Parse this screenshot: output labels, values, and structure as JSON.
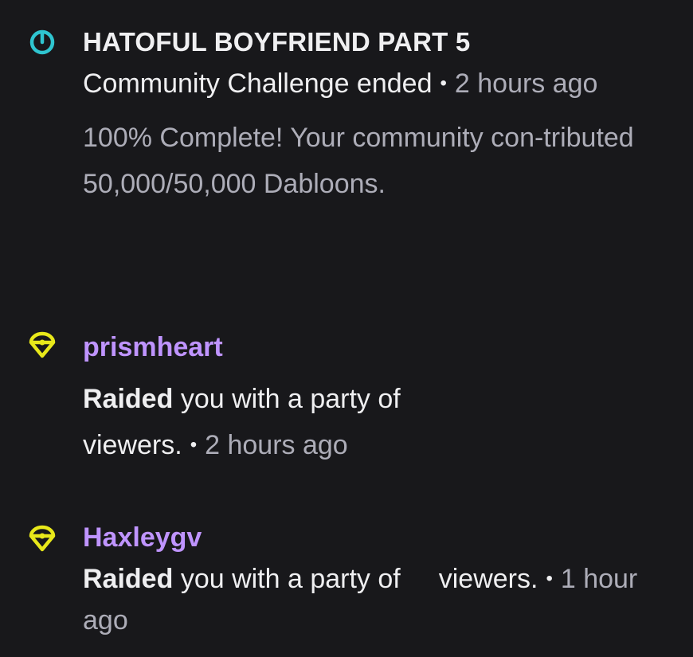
{
  "feed": {
    "items": [
      {
        "type": "community-challenge",
        "icon": "challenge-ring-icon",
        "title": "HATOFUL BOYFRIEND PART 5",
        "event_text": "Community Challenge ended",
        "time": "2 hours ago",
        "description": "100% Complete! Your community con-tributed 50,000/50,000 Dabloons."
      },
      {
        "type": "raid",
        "icon": "raid-icon",
        "user": "prismheart",
        "action": "Raided",
        "text": "you with a party of",
        "text_after": "viewers.",
        "time": "2 hours ago"
      },
      {
        "type": "raid",
        "icon": "raid-icon",
        "user": "Haxleygv",
        "action": "Raided",
        "text": "you with a party of",
        "text_after": "viewers.",
        "time": "1 hour ago"
      }
    ]
  },
  "colors": {
    "background": "#18181b",
    "text_primary": "#efeff1",
    "text_muted": "#adadb8",
    "username": "#bf94ff",
    "challenge_icon": "#2fc5d0",
    "raid_icon": "#e8e81a"
  }
}
